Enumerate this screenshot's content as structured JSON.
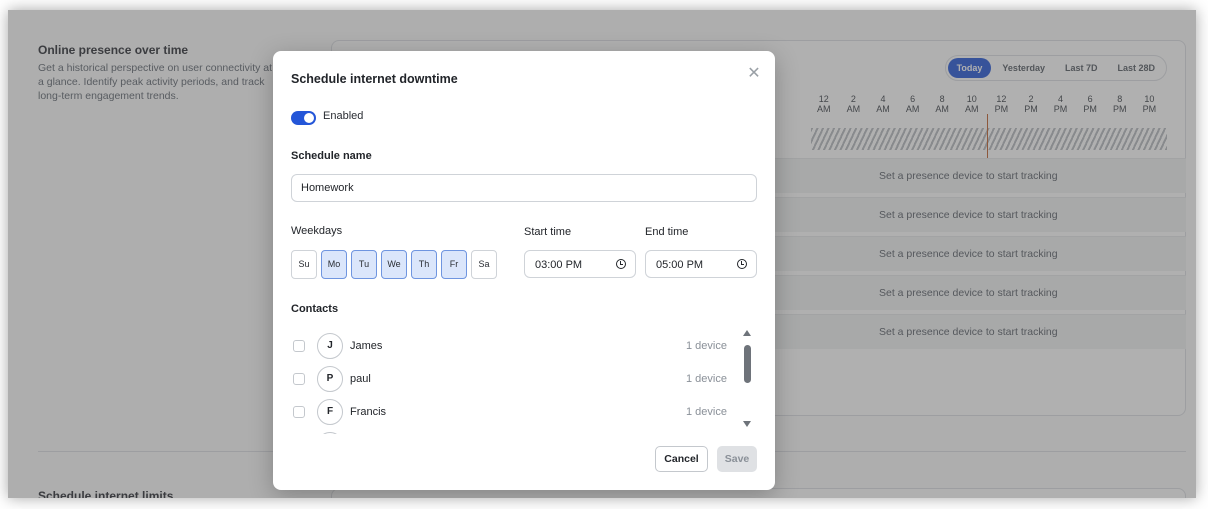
{
  "background": {
    "section_title": "Online presence over time",
    "section_desc": "Get a historical perspective on user connectivity at a glance. Identify peak activity periods, and track long-term engagement trends.",
    "range_tabs": [
      {
        "label": "Today",
        "active": true
      },
      {
        "label": "Yesterday",
        "active": false
      },
      {
        "label": "Last 7D",
        "active": false
      },
      {
        "label": "Last 28D",
        "active": false
      }
    ],
    "hours": [
      {
        "num": "12",
        "ampm": "AM"
      },
      {
        "num": "2",
        "ampm": "AM"
      },
      {
        "num": "4",
        "ampm": "AM"
      },
      {
        "num": "6",
        "ampm": "AM"
      },
      {
        "num": "8",
        "ampm": "AM"
      },
      {
        "num": "10",
        "ampm": "AM"
      },
      {
        "num": "12",
        "ampm": "PM"
      },
      {
        "num": "2",
        "ampm": "PM"
      },
      {
        "num": "4",
        "ampm": "PM"
      },
      {
        "num": "6",
        "ampm": "PM"
      },
      {
        "num": "8",
        "ampm": "PM"
      },
      {
        "num": "10",
        "ampm": "PM"
      }
    ],
    "tracking_rows": [
      "Set a presence device to start tracking",
      "Set a presence device to start tracking",
      "Set a presence device to start tracking",
      "Set a presence device to start tracking",
      "Set a presence device to start tracking"
    ],
    "section2_title": "Schedule internet limits"
  },
  "modal": {
    "title": "Schedule internet downtime",
    "close_icon": "close-icon",
    "enabled_label": "Enabled",
    "enabled": true,
    "schedule_name_label": "Schedule name",
    "schedule_name_value": "Homework",
    "weekdays_label": "Weekdays",
    "weekdays": [
      {
        "label": "Su",
        "selected": false
      },
      {
        "label": "Mo",
        "selected": true
      },
      {
        "label": "Tu",
        "selected": true
      },
      {
        "label": "We",
        "selected": true
      },
      {
        "label": "Th",
        "selected": true
      },
      {
        "label": "Fr",
        "selected": true
      },
      {
        "label": "Sa",
        "selected": false
      }
    ],
    "start_time_label": "Start time",
    "start_time_value": "03:00 PM",
    "end_time_label": "End time",
    "end_time_value": "05:00 PM",
    "contacts_label": "Contacts",
    "contacts": [
      {
        "initial": "J",
        "name": "James",
        "devices": "1 device"
      },
      {
        "initial": "P",
        "name": "paul",
        "devices": "1 device"
      },
      {
        "initial": "F",
        "name": "Francis",
        "devices": "1 device"
      }
    ],
    "cancel_label": "Cancel",
    "save_label": "Save"
  },
  "colors": {
    "accent": "#2456d8",
    "day_selected_bg": "#dbe6fb",
    "now_line": "#c0602c"
  }
}
